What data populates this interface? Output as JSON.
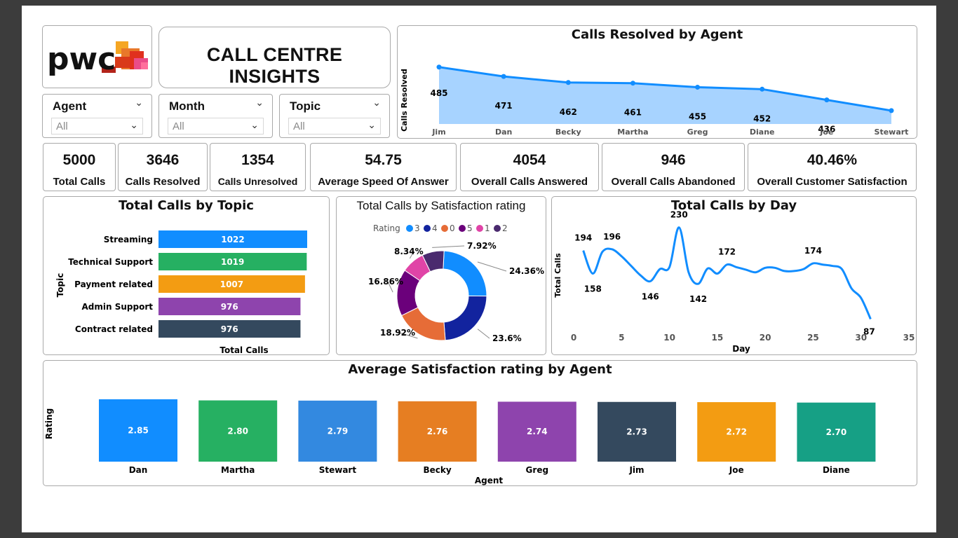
{
  "app": {
    "title": "CALL CENTRE INSIGHTS",
    "logo_text": "pwc"
  },
  "filters": [
    {
      "label": "Agent",
      "value": "All"
    },
    {
      "label": "Month",
      "value": "All"
    },
    {
      "label": "Topic",
      "value": "All"
    }
  ],
  "kpis": [
    {
      "value": "5000",
      "label": "Total Calls"
    },
    {
      "value": "3646",
      "label": "Calls Resolved"
    },
    {
      "value": "1354",
      "label": "Calls Unresolved"
    },
    {
      "value": "54.75",
      "label": "Average Speed Of Answer"
    },
    {
      "value": "4054",
      "label": "Overall Calls Answered"
    },
    {
      "value": "946",
      "label": "Overall Calls Abandoned"
    },
    {
      "value": "40.46%",
      "label": "Overall Customer Satisfaction"
    }
  ],
  "colors": {
    "accent": "#118dff",
    "area_fill": "#a7d3ff",
    "bar_palette": [
      "#118dff",
      "#26b062",
      "#f39c12",
      "#8e44ad",
      "#34495e"
    ],
    "donut_palette": [
      "#118dff",
      "#12239e",
      "#e66c37",
      "#6b007b",
      "#e044a7",
      "#4a2a6e"
    ],
    "agent_palette": [
      "#118dff",
      "#26b062",
      "#3389e0",
      "#e67e22",
      "#8e44ad",
      "#34495e",
      "#f39c12",
      "#16a085"
    ]
  },
  "chart_data": [
    {
      "id": "resolved",
      "type": "area",
      "title": "Calls Resolved by Agent",
      "xlabel": "",
      "ylabel": "Calls Resolved",
      "categories": [
        "Jim",
        "Dan",
        "Becky",
        "Martha",
        "Greg",
        "Diane",
        "Joe",
        "Stewart"
      ],
      "values": [
        485,
        471,
        462,
        461,
        455,
        452,
        436,
        420
      ],
      "labels": [
        "485",
        "471",
        "462",
        "461",
        "455",
        "452",
        "436",
        ""
      ],
      "ylim": [
        400,
        490
      ]
    },
    {
      "id": "topic",
      "type": "bar",
      "title": "Total Calls by Topic",
      "xlabel": "Total Calls",
      "ylabel": "Topic",
      "categories": [
        "Streaming",
        "Technical Support",
        "Payment related",
        "Admin Support",
        "Contract related"
      ],
      "values": [
        1022,
        1019,
        1007,
        976,
        976
      ],
      "xlim": [
        0,
        1022
      ]
    },
    {
      "id": "satisfaction",
      "type": "pie",
      "title": "Total Calls by Satisfaction rating",
      "legend_title": "Rating",
      "legend_position": "top",
      "slices": [
        {
          "name": "3",
          "pct": 24.36,
          "label": "24.36%"
        },
        {
          "name": "4",
          "pct": 23.6,
          "label": "23.6%"
        },
        {
          "name": "0",
          "pct": 18.92,
          "label": "18.92%"
        },
        {
          "name": "5",
          "pct": 16.86,
          "label": "16.86%"
        },
        {
          "name": "1",
          "pct": 8.34,
          "label": "8.34%"
        },
        {
          "name": "2",
          "pct": 7.92,
          "label": "7.92%"
        }
      ]
    },
    {
      "id": "byday",
      "type": "line",
      "title": "Total Calls by Day",
      "xlabel": "Day",
      "ylabel": "Total Calls",
      "x": [
        1,
        2,
        3,
        4,
        5,
        6,
        7,
        8,
        9,
        10,
        11,
        12,
        13,
        14,
        15,
        16,
        17,
        18,
        19,
        20,
        21,
        22,
        23,
        24,
        25,
        26,
        27,
        28,
        29,
        30,
        31
      ],
      "values": [
        194,
        158,
        192,
        196,
        185,
        170,
        155,
        146,
        165,
        168,
        230,
        160,
        142,
        166,
        158,
        172,
        168,
        164,
        160,
        167,
        167,
        162,
        162,
        165,
        174,
        172,
        170,
        165,
        135,
        120,
        87
      ],
      "point_labels": {
        "1": "194",
        "2": "158",
        "4": "196",
        "8": "146",
        "11": "230",
        "13": "142",
        "16": "172",
        "25": "174",
        "31": "87"
      },
      "xticks": [
        "0",
        "5",
        "10",
        "15",
        "20",
        "25",
        "30",
        "35"
      ],
      "xlim": [
        0,
        35
      ],
      "ylim": [
        70,
        245
      ],
      "grid": false
    },
    {
      "id": "rating",
      "type": "bar",
      "title": "Average Satisfaction rating by Agent",
      "xlabel": "Agent",
      "ylabel": "Rating",
      "categories": [
        "Dan",
        "Martha",
        "Stewart",
        "Becky",
        "Greg",
        "Jim",
        "Joe",
        "Diane"
      ],
      "values": [
        2.85,
        2.8,
        2.79,
        2.76,
        2.74,
        2.73,
        2.72,
        2.7
      ],
      "labels": [
        "2.85",
        "2.80",
        "2.79",
        "2.76",
        "2.74",
        "2.73",
        "2.72",
        "2.70"
      ],
      "ylim": [
        0,
        2.85
      ]
    }
  ]
}
